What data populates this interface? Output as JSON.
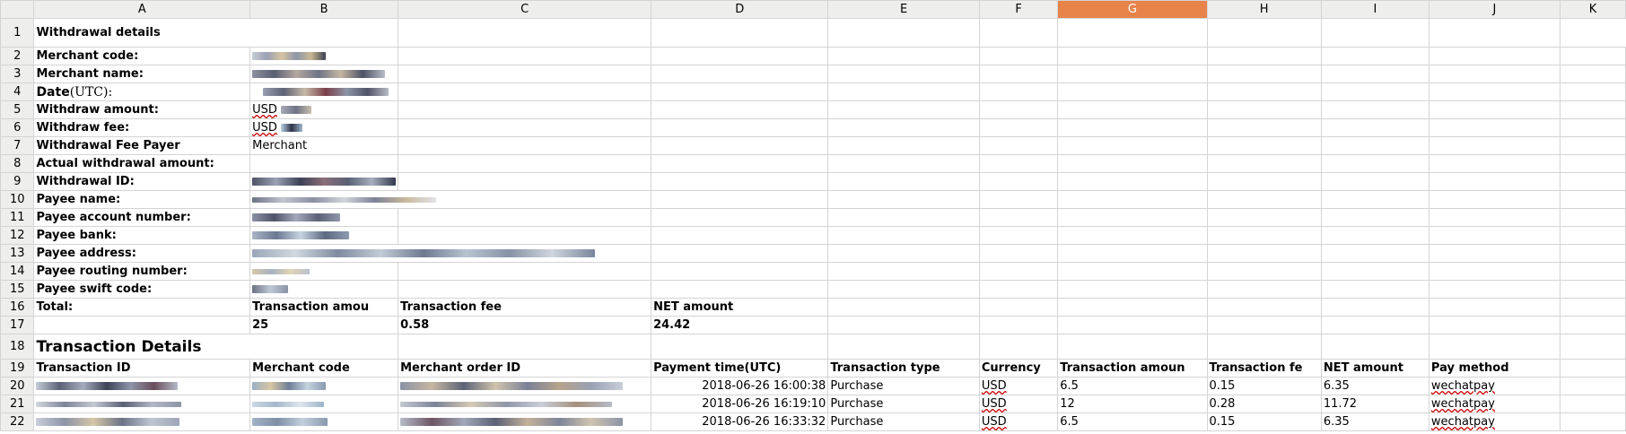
{
  "columns": [
    "A",
    "B",
    "C",
    "D",
    "E",
    "F",
    "G",
    "H",
    "I",
    "J",
    "K"
  ],
  "selected_column": "G",
  "row_numbers": [
    "1",
    "2",
    "3",
    "4",
    "5",
    "6",
    "7",
    "8",
    "9",
    "10",
    "11",
    "12",
    "13",
    "14",
    "15",
    "16",
    "17",
    "18",
    "19",
    "20",
    "21",
    "22"
  ],
  "withdrawal": {
    "title": "Withdrawal details",
    "labels": {
      "merchant_code": "Merchant code:",
      "merchant_name": "Merchant name:",
      "date_prefix": "Date",
      "date_suffix": "(UTC):",
      "withdraw_amount": "Withdraw amount:",
      "withdraw_fee": "Withdraw fee:",
      "fee_payer": "Withdrawal Fee Payer",
      "actual_amount": "Actual withdrawal amount:",
      "withdrawal_id": "Withdrawal ID:",
      "payee_name": "Payee name:",
      "payee_account": "Payee account number:",
      "payee_bank": "Payee bank:",
      "payee_address": "Payee address:",
      "payee_routing": "Payee routing number:",
      "payee_swift": "Payee swift code:"
    },
    "withdraw_amount_currency": "USD",
    "withdraw_fee_currency": "USD",
    "fee_payer_value": "Merchant"
  },
  "totals": {
    "label": "Total:",
    "headers": [
      "Transaction amou",
      "Transaction fee",
      "NET amount"
    ],
    "values": [
      "25",
      "0.58",
      "24.42"
    ]
  },
  "transactions": {
    "title": "Transaction Details",
    "headers": [
      "Transaction ID",
      "Merchant code",
      "Merchant order ID",
      "Payment time(UTC)",
      "Transaction type",
      "Currency",
      "Transaction amoun",
      "Transaction fe",
      "NET amount",
      "Pay method"
    ],
    "rows": [
      {
        "time": "2018-06-26 16:00:38",
        "type": "Purchase",
        "currency": "USD",
        "amount": "6.5",
        "fee": "0.15",
        "net": "6.35",
        "method": "wechatpay"
      },
      {
        "time": "2018-06-26 16:19:10",
        "type": "Purchase",
        "currency": "USD",
        "amount": "12",
        "fee": "0.28",
        "net": "11.72",
        "method": "wechatpay"
      },
      {
        "time": "2018-06-26 16:33:32",
        "type": "Purchase",
        "currency": "USD",
        "amount": "6.5",
        "fee": "0.15",
        "net": "6.35",
        "method": "wechatpay"
      }
    ]
  },
  "colors": {
    "header_bg": "#eeeeec",
    "selected_header": "#e8834a",
    "grid_line": "#d4d4d4",
    "spellcheck_underline": "#cc0000"
  }
}
